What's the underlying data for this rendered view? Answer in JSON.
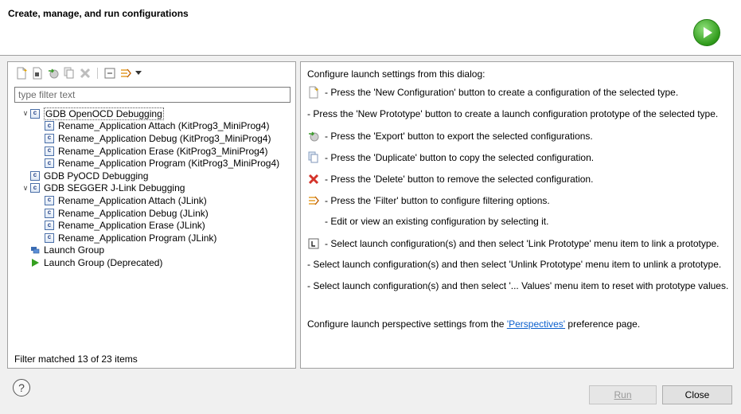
{
  "header": {
    "title": "Create, manage, and run configurations"
  },
  "toolbar": {
    "icons": [
      "new-configuration-icon",
      "new-prototype-icon",
      "export-icon",
      "duplicate-icon",
      "delete-icon",
      "collapse-all-icon",
      "filter-icon",
      "dropdown-arrow-icon"
    ]
  },
  "filter": {
    "placeholder": "type filter text",
    "value": ""
  },
  "tree": [
    {
      "label": "GDB OpenOCD Debugging",
      "level": 0,
      "expanded": true,
      "selected": true
    },
    {
      "label": "Rename_Application Attach (KitProg3_MiniProg4)",
      "level": 1
    },
    {
      "label": "Rename_Application Debug (KitProg3_MiniProg4)",
      "level": 1
    },
    {
      "label": "Rename_Application Erase (KitProg3_MiniProg4)",
      "level": 1
    },
    {
      "label": "Rename_Application Program (KitProg3_MiniProg4)",
      "level": 1
    },
    {
      "label": "GDB PyOCD Debugging",
      "level": 0
    },
    {
      "label": "GDB SEGGER J-Link Debugging",
      "level": 0,
      "expanded": true
    },
    {
      "label": "Rename_Application Attach (JLink)",
      "level": 1
    },
    {
      "label": "Rename_Application Debug (JLink)",
      "level": 1
    },
    {
      "label": "Rename_Application Erase (JLink)",
      "level": 1
    },
    {
      "label": "Rename_Application Program (JLink)",
      "level": 1
    },
    {
      "label": "Launch Group",
      "level": 0,
      "icon": "launch-group-icon"
    },
    {
      "label": "Launch Group (Deprecated)",
      "level": 0,
      "icon": "play-icon"
    }
  ],
  "filter_status": "Filter matched 13 of 23 items",
  "info": {
    "intro": "Configure launch settings from this dialog:",
    "lines": [
      "- Press the 'New Configuration' button to create a configuration of the selected type.",
      "- Press the 'New Prototype' button to create a launch configuration prototype of the selected type.",
      "- Press the 'Export' button to export the selected configurations.",
      "- Press the 'Duplicate' button to copy the selected configuration.",
      "- Press the 'Delete' button to remove the selected configuration.",
      "- Press the 'Filter' button to configure filtering options.",
      "- Edit or view an existing configuration by selecting it.",
      "- Select launch configuration(s) and then select 'Link Prototype' menu item to link a prototype.",
      "- Select launch configuration(s) and then select 'Unlink Prototype' menu item to unlink a prototype.",
      "- Select launch configuration(s) and then select '... Values' menu item to reset with prototype values."
    ],
    "perspectives_prefix": "Configure launch perspective settings from the ",
    "perspectives_link": "'Perspectives'",
    "perspectives_suffix": " preference page."
  },
  "buttons": {
    "run": "Run",
    "close": "Close",
    "help": "?"
  },
  "colors": {
    "link": "#0b5fcd",
    "accent_green": "#2f9a1a",
    "delete_red": "#d4332a"
  }
}
